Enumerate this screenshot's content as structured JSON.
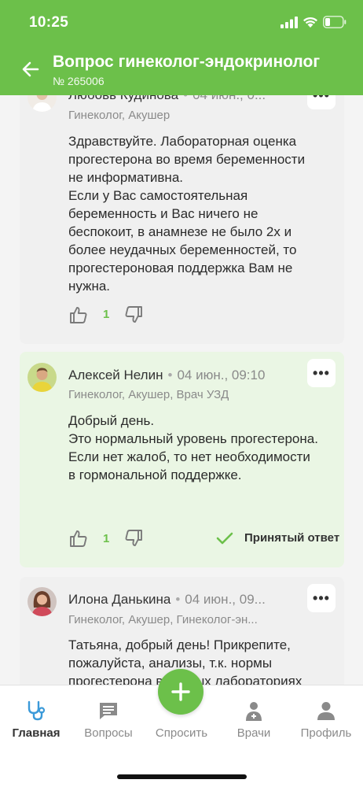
{
  "status_bar": {
    "time": "10:25"
  },
  "header": {
    "title": "Вопрос гинеколог-эндокринолог",
    "subtitle": "№ 265006"
  },
  "answers": [
    {
      "name": "Любовь Кудинова",
      "date": "04 июн., 0...",
      "specialty": "Гинеколог, Акушер",
      "text": "Здравствуйте. Лабораторная оценка прогестерона во время беременности не информативна.\nЕсли у Вас самостоятельная беременность и Вас ничего не беспокоит, в анамнезе не было 2х и более неудачных беременностей, то прогестероновая поддержка Вам не нужна.",
      "likes": "1"
    },
    {
      "name": "Алексей Нелин",
      "date": "04 июн., 09:10",
      "specialty": "Гинеколог, Акушер, Врач УЗД",
      "text": "Добрый день.\nЭто нормальный уровень прогестерона.\nЕсли нет жалоб, то нет необходимости в гормональной поддержке.",
      "likes": "1",
      "accepted_label": "Принятый ответ"
    },
    {
      "name": "Илона Данькина",
      "date": "04 июн., 09...",
      "specialty": "Гинеколог, Акушер, Гинеколог-эн...",
      "text": "Татьяна, добрый день! Прикрепите, пожалуйста, анализы, т.к. нормы прогестерона в разных лабораториях"
    }
  ],
  "more_label": "•••",
  "nav": {
    "home": "Главная",
    "questions": "Вопросы",
    "ask": "Спросить",
    "doctors": "Врачи",
    "profile": "Профиль"
  },
  "colors": {
    "accent": "#6cc04a",
    "accepted_bg": "#eaf6e4"
  }
}
